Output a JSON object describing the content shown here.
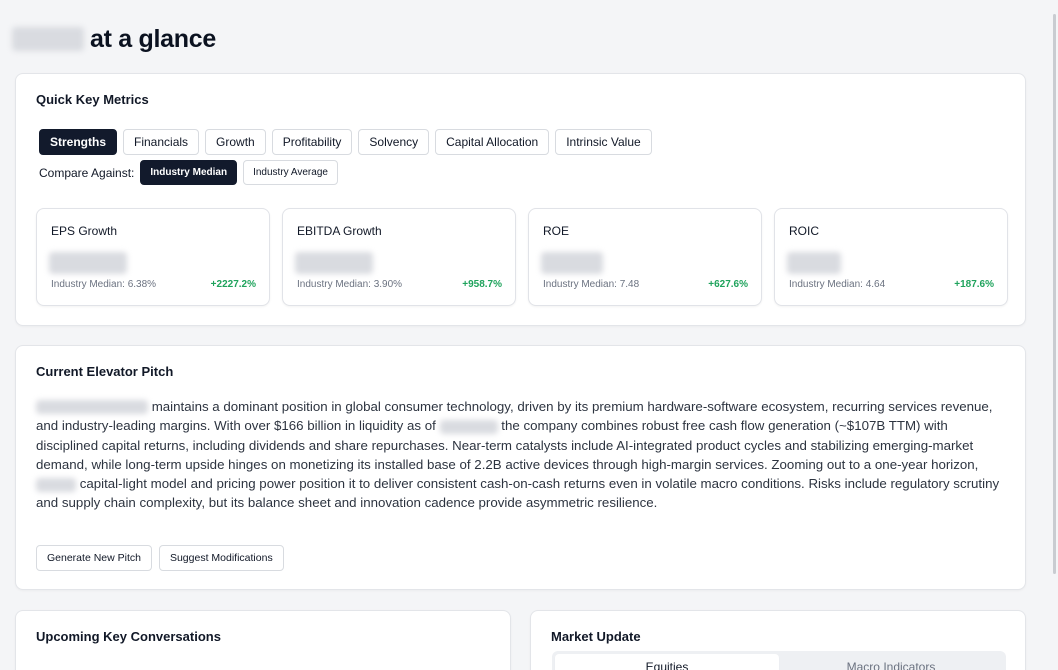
{
  "page": {
    "title_suffix": "at a glance"
  },
  "metrics": {
    "title": "Quick Key Metrics",
    "tabs": [
      {
        "label": "Strengths",
        "active": true
      },
      {
        "label": "Financials",
        "active": false
      },
      {
        "label": "Growth",
        "active": false
      },
      {
        "label": "Profitability",
        "active": false
      },
      {
        "label": "Solvency",
        "active": false
      },
      {
        "label": "Capital Allocation",
        "active": false
      },
      {
        "label": "Intrinsic Value",
        "active": false
      }
    ],
    "compare_label": "Compare Against:",
    "compare_options": [
      {
        "label": "Industry Median",
        "active": true
      },
      {
        "label": "Industry Average",
        "active": false
      }
    ],
    "cards": [
      {
        "name": "EPS Growth",
        "median": "Industry Median: 6.38%",
        "delta": "+2227.2%"
      },
      {
        "name": "EBITDA Growth",
        "median": "Industry Median: 3.90%",
        "delta": "+958.7%"
      },
      {
        "name": "ROE",
        "median": "Industry Median: 7.48",
        "delta": "+627.6%"
      },
      {
        "name": "ROIC",
        "median": "Industry Median: 4.64",
        "delta": "+187.6%"
      }
    ],
    "accent_positive": "#1fa35c",
    "active_chip_color": "#121a2c"
  },
  "pitch": {
    "title": "Current Elevator Pitch",
    "seg1": "maintains a dominant position in global consumer technology, driven by its premium hardware-software ecosystem, recurring services revenue, and industry-leading margins. With over $166 billion in liquidity as of",
    "seg2": "the company combines robust free cash flow generation (~$107B TTM) with disciplined capital returns, including dividends and share repurchases. Near-term catalysts include AI-integrated product cycles and stabilizing emerging-market demand, while long-term upside hinges on monetizing its installed base of 2.2B active devices through high-margin services. Zooming out to a one-year horizon,",
    "seg3": "capital-light model and pricing power position it to deliver consistent cash-on-cash returns even in volatile macro conditions. Risks include regulatory scrutiny and supply chain complexity, but its balance sheet and innovation cadence provide asymmetric resilience.",
    "generate_label": "Generate New Pitch",
    "suggest_label": "Suggest Modifications"
  },
  "conversations": {
    "title": "Upcoming Key Conversations"
  },
  "market": {
    "title": "Market Update",
    "tabs": [
      {
        "label": "Equities",
        "active": true
      },
      {
        "label": "Macro Indicators",
        "active": false
      }
    ]
  }
}
